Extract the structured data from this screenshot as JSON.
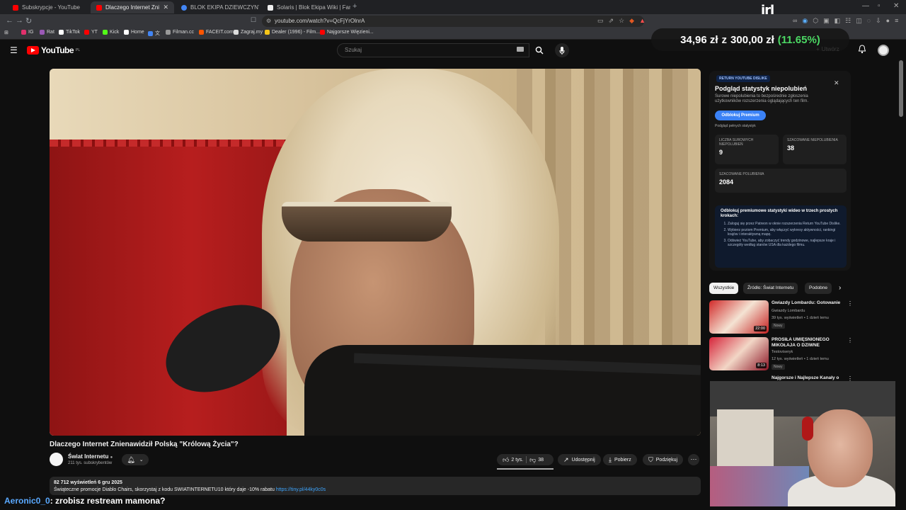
{
  "browser": {
    "tabs": [
      {
        "title": "Subskrypcje - YouTube",
        "favicon_color": "#ff0000",
        "active": false
      },
      {
        "title": "Dlaczego Internet Znienawidził",
        "favicon_color": "#ff0000",
        "active": true
      },
      {
        "title": "BLOK EKIPA DZIEWCZYNY - Szukaj w",
        "favicon_color": "#4285f4",
        "active": false
      },
      {
        "title": "Solaris | Blok Ekipa Wiki | Fandom",
        "favicon_color": "#eeeeee",
        "active": false
      }
    ],
    "url": "youtube.com/watch?v=QcFjYrOlnrA",
    "bookmarks": [
      {
        "label": "IG",
        "color": "#e1306c"
      },
      {
        "label": "Rat",
        "color": "#9b59b6"
      },
      {
        "label": "TikTok",
        "color": "#ffffff"
      },
      {
        "label": "YT",
        "color": "#ff0000"
      },
      {
        "label": "Kick",
        "color": "#53fc18"
      },
      {
        "label": "Home",
        "color": "#ffffff"
      },
      {
        "label": "文",
        "color": "#4285f4"
      },
      {
        "label": "Filman.cc",
        "color": "#999999"
      },
      {
        "label": "FACEIT.com",
        "color": "#ff5500"
      },
      {
        "label": "Zagraj.my",
        "color": "#dddddd"
      },
      {
        "label": "Dealer (1996) - Film...",
        "color": "#f5c518"
      },
      {
        "label": "Najgorsze Więzieni...",
        "color": "#ff0000"
      }
    ]
  },
  "overlay": {
    "logo_text": "irl",
    "donation": {
      "current": "34,96 zł",
      "separator": "z",
      "goal": "300,00 zł",
      "percent": "(11.65%)",
      "progress": 0.1165
    }
  },
  "youtube": {
    "logo_text": "YouTube",
    "logo_region": "PL",
    "search_placeholder": "Szukaj",
    "create_label": "Utwórz",
    "video": {
      "title": "Dlaczego Internet Znienawidził Polską \"Królową Życia\"?",
      "channel": "Świat Internetu",
      "subscribers": "211 tys. subskrybentów",
      "likes": "2 tys.",
      "dislikes": "38",
      "share_label": "Udostępnij",
      "download_label": "Pobierz",
      "thanks_label": "Podziękuj",
      "views_date": "82 712 wyświetleń  6 gru 2025",
      "description": "Świąteczne promocje Diablo Chairs, skorzystaj z kodu SWIATINTERNETU10 który daje -10% rabatu",
      "description_link": "https://tiny.pl/44ky0c0s"
    },
    "dislike_panel": {
      "badge": "RETURN YOUTUBE DISLIKE",
      "title": "Podgląd statystyk niepolubień",
      "description": "Surowe niepolubienia to bezpośrednie zgłoszenia użytkowników rozszerzenia oglądających ten film.",
      "premium_button": "Odblokuj Premium",
      "full_stats_link": "Podgląd pełnych statystyk",
      "raw_label": "LICZBA SUROWYCH NIEPOLUBIEŃ",
      "raw_value": "9",
      "est_dislikes_label": "SZACOWANE NIEPOLUBIENIA",
      "est_dislikes_value": "38",
      "est_likes_label": "SZACOWANE POLUBIENIA",
      "est_likes_value": "2084",
      "unlock_title": "Odblokuj premiumowe statystyki wideo w trzech prostych krokach:",
      "steps": [
        "Zaloguj się przez Patreon w oknie rozszerzenia Return YouTube Dislike.",
        "Wybierz poziom Premium, aby włączyć wykresy aktywności, rankingi krajów i interaktywną mapę.",
        "Odśwież YouTube, aby zobaczyć trendy godzinowe, najlepsze kraje i szczegóły według stanów USA dla każdego filmu."
      ]
    },
    "chips": [
      "Wszystkie",
      "Źródło: Świat Internetu",
      "Podobne"
    ],
    "recommendations": [
      {
        "title": "Gwiazdy Lombardu: Gotowanie",
        "channel": "Gwiazdy Lombardu",
        "views": "39 tys. wyświetleń • 1 dzień temu",
        "badge": "Nowy",
        "duration": "22:00"
      },
      {
        "title": "PROSIŁA UMIĘŚNIONEGO MIKOŁAJA O DZIWNE RZECZY...",
        "channel": "Testoviseryk",
        "views": "12 tys. wyświetleń • 1 dzień temu",
        "badge": "Nowy",
        "duration": "8:13"
      },
      {
        "title": "Najgorsze i Najlepsze Kanały o",
        "channel": "",
        "views": "",
        "badge": "",
        "duration": ""
      }
    ]
  },
  "chat": {
    "user": "Aeronic0_0",
    "message": ": zrobisz restream mamona?"
  }
}
